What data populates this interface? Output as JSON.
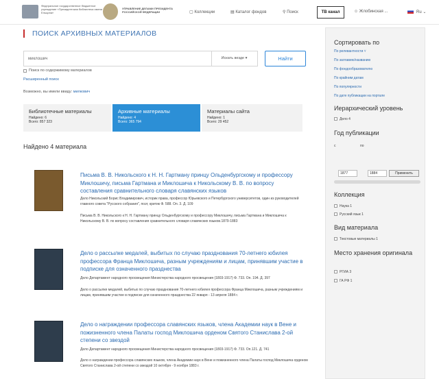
{
  "header": {
    "org1": "Федеральное государственное бюджетное учреждение «Президентская библиотека имени Б.Н. Ельцина»",
    "org2": "УПРАВЛЕНИЕ ДЕЛАМИ ПРЕЗИДЕНТА РОССИЙСКОЙ ФЕДЕРАЦИИ",
    "nav": [
      "Коллекции",
      "Каталог фондов",
      "Поиск"
    ],
    "tv": "ТВ канал",
    "user": "Жлобинская ...",
    "lang": "Ru"
  },
  "page": {
    "title": "ПОИСК АРХИВНЫХ МАТЕРИАЛОВ"
  },
  "search": {
    "value": "миклошич",
    "where": "Искать везде",
    "button": "Найти",
    "content_search": "Поиск по содержимому материалов",
    "advanced": "Расширенный поиск",
    "suggest_prefix": "Возможно, вы имели ввиду:",
    "suggest": "милкович"
  },
  "tabs": [
    {
      "label": "Библиотечные материалы",
      "found": "Найдено: 6",
      "total": "Всего: 857 323"
    },
    {
      "label": "Архивные материалы",
      "found": "Найдено: 4",
      "total": "Всего: 365 794"
    },
    {
      "label": "Материалы сайта",
      "found": "Найдено: 1",
      "total": "Всего: 29 452"
    }
  ],
  "results_count": "Найдено 4 материала",
  "results": [
    {
      "title": "Письма В. В. Никольского к Н. Н. Гартману принцу Ольденбургскому и профессору Миклошичу, письма Гартмана и Миклошича к Никольскому В. В. по вопросу составления сравнительного словаря славянских языков",
      "meta": "Дело Никольский Борис Владимирович, историк права, профессор Юрьевского и Петербургского университетов, один из руководителей главного совета \"Русского собрания\", поэт, критик Ф. 588. Оп. 3. Д. 109",
      "desc": "Письма В. В. Никольского к Н. Н. Гартману принцу Ольденбургскому и профессору Миклошичу, письма Гартмана и Миклошича к Никольскому В. В. по вопросу составления сравнительного словаря славянских языков.1879-1883"
    },
    {
      "title": "Дело о рассылке медалей, выбитых по случаю празднования 70-летнего юбилея профессора Франца Миклошича, разным учреждениям и лицам, принявшим участие в подписке для означенного празднества",
      "meta": "Дело Департамент народного просвещения Министерства народного просвещения (1803-1917) Ф. 733. Оп. 194. Д. 397",
      "desc": "Дело о рассылке медалей, выбитых по случаю празднования 70-летнего юбилея профессора Франца Миклошича, разным учреждениям и лицам, принявшим участие в подписке для означенного празднества 22 января - 13 апреля 1884 г."
    },
    {
      "title": "Дело о награждении профессора славянских языков, члена Академии наук в Вене и пожизненного члена Палаты господ Миклошича орденом Святого Станислава 2-ой степени со звездой",
      "meta": "Дело Департамент народного просвещения Министерства народного просвещения (1803-1917) Ф. 733. Оп.121. Д. 741",
      "desc": "Дело о награждении профессора славянских языков, члена Академии наук в Вене и пожизненного члена Палаты господ Миклошича орденом Святого Станислава 2-ой степени со звездой 10 октября - 9 ноября 1883 г."
    }
  ],
  "sidebar": {
    "sort_title": "Сортировать по",
    "sort": [
      "По релевантности",
      "По заглавию/названию",
      "По фондообразователю",
      "По крайним датам",
      "По популярности",
      "По дате публикации на портале"
    ],
    "hier_title": "Иерархический уровень",
    "hier": [
      "Дело 4"
    ],
    "year_title": "Год публикации",
    "year_c": "с",
    "year_from": "1877",
    "year_po": "по",
    "year_to": "1884",
    "apply": "Применить",
    "coll_title": "Коллекция",
    "coll": [
      "Наука 1",
      "Русский язык 1"
    ],
    "type_title": "Вид материала",
    "type": [
      "Текстовые материалы 1"
    ],
    "loc_title": "Место хранения оригинала",
    "loc": [
      "РГИА 3",
      "ГА РФ 1"
    ]
  }
}
